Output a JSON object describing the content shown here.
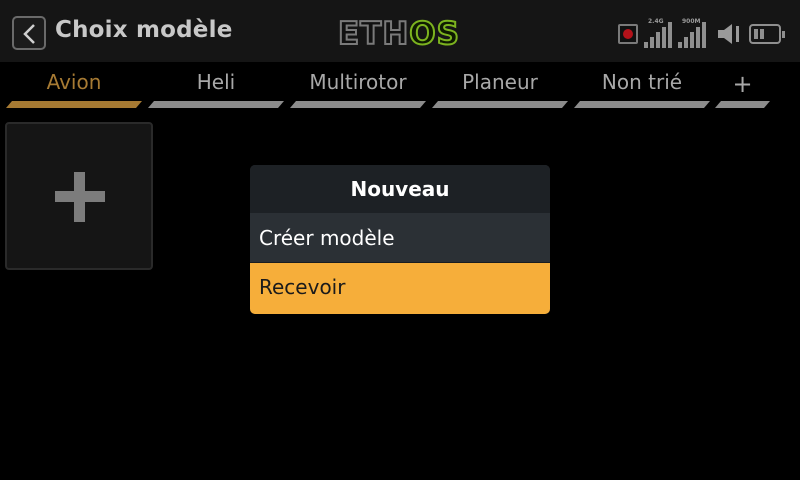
{
  "header": {
    "back_icon": "chevron-left-icon",
    "title": "Choix modèle",
    "logo": {
      "part1": "ETH",
      "part2": "OS",
      "accent_color": "#7cb31f"
    },
    "status": {
      "record_icon": "record-icon",
      "signal1_label": "2.4G",
      "signal2_label": "900M",
      "speaker_icon": "speaker-icon",
      "battery_icon": "battery-icon"
    }
  },
  "tabs": [
    {
      "label": "Avion",
      "active": true
    },
    {
      "label": "Heli",
      "active": false
    },
    {
      "label": "Multirotor",
      "active": false
    },
    {
      "label": "Planeur",
      "active": false
    },
    {
      "label": "Non trié",
      "active": false
    },
    {
      "label": "+",
      "active": false
    }
  ],
  "tile": {
    "icon": "plus-icon"
  },
  "dialog": {
    "title": "Nouveau",
    "items": [
      {
        "label": "Créer modèle",
        "selected": false
      },
      {
        "label": "Recevoir",
        "selected": true
      }
    ],
    "selected_color": "#f6ae3a"
  },
  "colors": {
    "background": "#000000",
    "tab_active": "#a67a33",
    "tab_inactive": "#8c8c8c"
  }
}
